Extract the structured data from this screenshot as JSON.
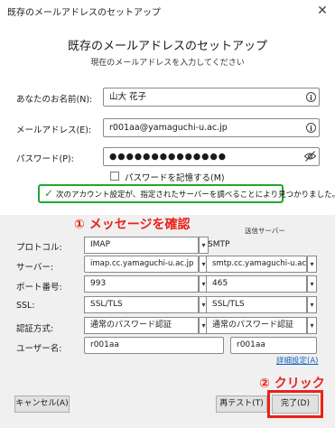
{
  "window": {
    "title": "既存のメールアドレスのセットアップ",
    "close_glyph": "✕"
  },
  "header": {
    "title": "既存のメールアドレスのセットアップ",
    "subtitle": "現在のメールアドレスを入力してください"
  },
  "form": {
    "name_label": "あなたのお名前(N):",
    "name_value": "山大 花子",
    "email_label": "メールアドレス(E):",
    "email_value": "r001aa@yamaguchi-u.ac.jp",
    "password_label": "パスワード(P):",
    "password_value": "●●●●●●●●●●●●●●",
    "remember_label": "パスワードを記憶する(M)",
    "remember_checked": false
  },
  "status": {
    "message": "次のアカウント設定が、指定されたサーバーを調べることにより見つかりました。",
    "color": "#21a82f"
  },
  "annotations": {
    "confirm": "① メッセージを確認",
    "click": "② クリック",
    "color": "#e8221b"
  },
  "server": {
    "incoming_header": "",
    "outgoing_header": "送信サーバー",
    "protocol_label": "プロトコル:",
    "protocol_in": "IMAP",
    "protocol_out": "SMTP",
    "server_label": "サーバー:",
    "server_in": "imap.cc.yamaguchi-u.ac.jp",
    "server_out": "smtp.cc.yamaguchi-u.ac.jp",
    "port_label": "ポート番号:",
    "port_in": "993",
    "port_out": "465",
    "ssl_label": "SSL:",
    "ssl_in": "SSL/TLS",
    "ssl_out": "SSL/TLS",
    "auth_label": "認証方式:",
    "auth_in": "通常のパスワード認証",
    "auth_out": "通常のパスワード認証",
    "user_label": "ユーザー名:",
    "user_in": "r001aa",
    "user_out": "r001aa",
    "advanced_link": "詳細設定(A)"
  },
  "buttons": {
    "cancel": "キャンセル(A)",
    "retest": "再テスト(T)",
    "done": "完了(D)"
  }
}
